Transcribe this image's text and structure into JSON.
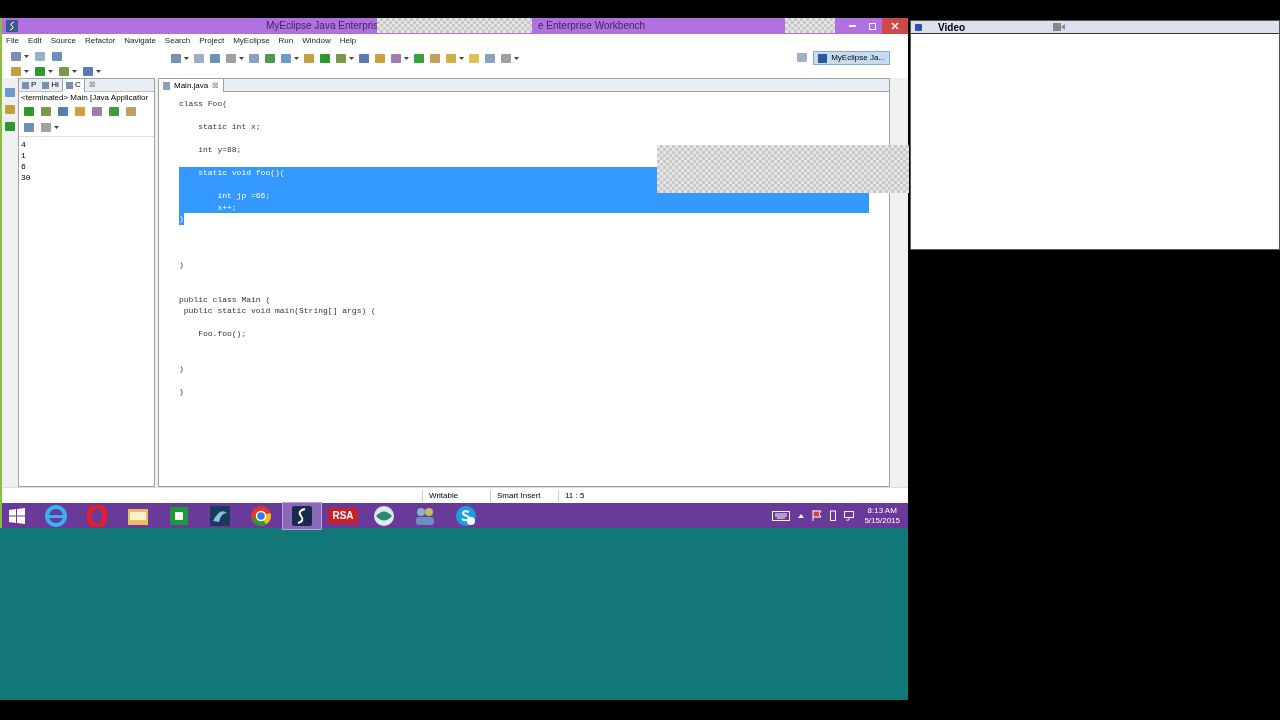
{
  "window": {
    "title_parts": [
      "MyEclipse Java Enterpris",
      "e Enterprise Workbench"
    ]
  },
  "menu": [
    "File",
    "Edit",
    "Source",
    "Refactor",
    "Navigate",
    "Search",
    "Project",
    "MyEclipse",
    "Run",
    "Window",
    "Help"
  ],
  "perspective": {
    "label": "MyEclipse Ja...",
    "selected": true
  },
  "left_panel": {
    "tabs": [
      {
        "label": "P",
        "selected": false
      },
      {
        "label": "Hi",
        "selected": false
      },
      {
        "label": "C",
        "selected": true
      }
    ],
    "close": "⊠",
    "console_title": "<terminated> Main [Java Applicatior",
    "output": [
      "4",
      "1",
      "6",
      "30"
    ]
  },
  "editor": {
    "tab": "Main.java",
    "close": "⊠",
    "lines": [
      {
        "text": "class Foo(",
        "selected": false
      },
      {
        "selected": false
      },
      {
        "text": "    static int x;",
        "selected": false
      },
      {
        "selected": false
      },
      {
        "text": "    int y=88;",
        "selected": false
      },
      {
        "selected": false
      },
      {
        "text": "    static void foo()(",
        "selected": true
      },
      {
        "selected": true
      },
      {
        "text": "        int jp =66;",
        "selected": true
      },
      {
        "text": "        x++;",
        "selected": true
      },
      {
        "text": ")",
        "selected": true
      },
      {
        "selected": false
      },
      {
        "selected": false
      },
      {
        "selected": false
      },
      {
        "text": ")",
        "selected": false
      },
      {
        "selected": false
      },
      {
        "selected": false
      },
      {
        "text": "public class Main (",
        "selected": false
      },
      {
        "text": " public static void main(String[] args) (",
        "selected": false
      },
      {
        "selected": false
      },
      {
        "text": "    Foo.foo();",
        "selected": false
      },
      {
        "selected": false
      },
      {
        "selected": false
      },
      {
        "text": ")",
        "selected": false
      },
      {
        "selected": false
      },
      {
        "text": ")",
        "selected": false
      }
    ]
  },
  "status_bar": [
    "Writable",
    "Smart Insert",
    "11 : 5"
  ],
  "taskbar": {
    "apps": [
      {
        "kind": "browser",
        "selected": false
      },
      {
        "kind": "opera",
        "selected": false
      },
      {
        "kind": "folder",
        "selected": false
      },
      {
        "kind": "store",
        "selected": false
      },
      {
        "kind": "dolphin",
        "selected": false
      },
      {
        "kind": "chrome",
        "selected": false
      },
      {
        "kind": "eclipse",
        "selected": true
      },
      {
        "kind": "rsa",
        "label": "RSA",
        "selected": false
      },
      {
        "kind": "globe",
        "selected": false
      },
      {
        "kind": "people",
        "selected": false
      },
      {
        "kind": "skype",
        "selected": false
      }
    ],
    "time": "8:13 AM",
    "date": "5/15/2015"
  },
  "video_panel": {
    "title": "Video"
  }
}
